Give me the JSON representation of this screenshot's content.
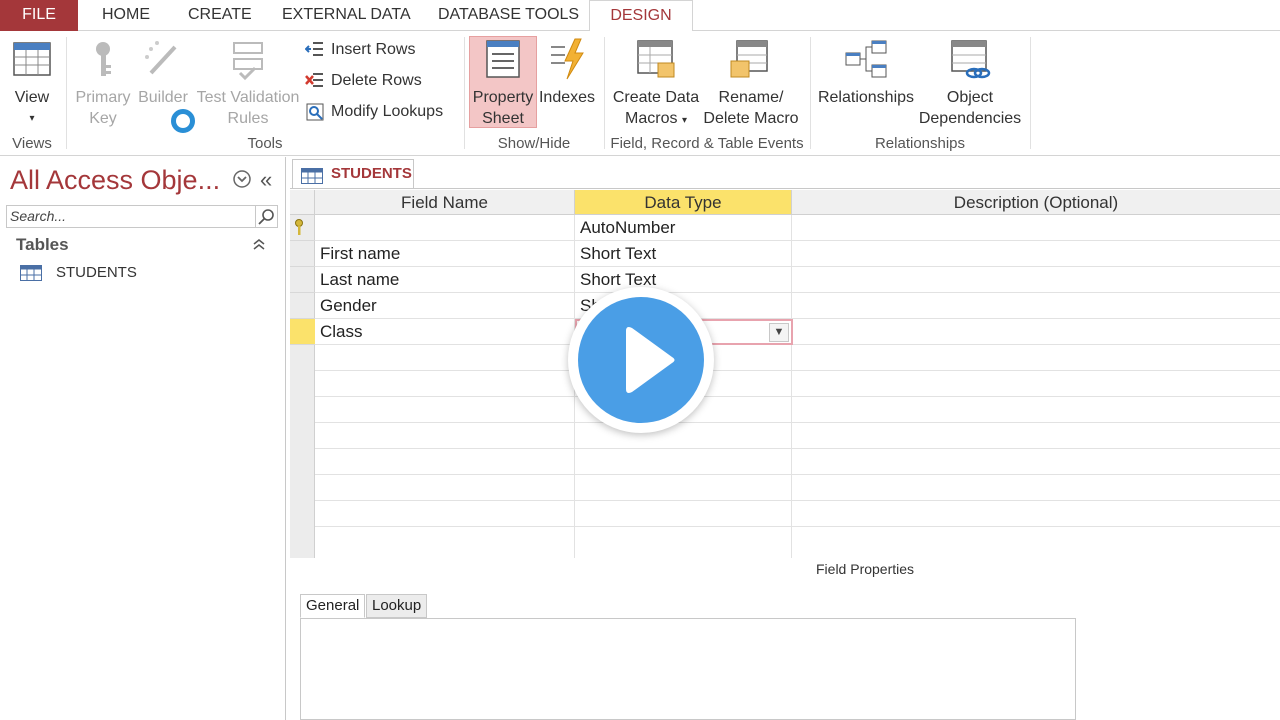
{
  "ribbon_tabs": [
    "FILE",
    "HOME",
    "CREATE",
    "EXTERNAL DATA",
    "DATABASE TOOLS",
    "DESIGN"
  ],
  "ribbon": {
    "views": {
      "view": "View",
      "label": "Views"
    },
    "tools": {
      "primary_key": "Primary\nKey",
      "builder": "Builder",
      "test_validation": "Test Validation\nRules",
      "insert_rows": "Insert Rows",
      "delete_rows": "Delete Rows",
      "modify_lookups": "Modify Lookups",
      "label": "Tools"
    },
    "showhide": {
      "property_sheet": "Property\nSheet",
      "indexes": "Indexes",
      "label": "Show/Hide"
    },
    "events": {
      "create_data_macros": "Create Data\nMacros",
      "rename_delete_macro": "Rename/\nDelete Macro",
      "label": "Field, Record & Table Events"
    },
    "relationships": {
      "relationships": "Relationships",
      "object_dependencies": "Object\nDependencies",
      "label": "Relationships"
    }
  },
  "nav": {
    "title": "All Access Obje...",
    "search_placeholder": "Search...",
    "section": "Tables",
    "items": [
      "STUDENTS"
    ]
  },
  "document": {
    "tab": "STUDENTS",
    "headers": [
      "Field Name",
      "Data Type",
      "Description (Optional)"
    ],
    "rows": [
      {
        "field": "",
        "type": "AutoNumber",
        "key": true
      },
      {
        "field": "First name",
        "type": "Short Text"
      },
      {
        "field": "Last name",
        "type": "Short Text"
      },
      {
        "field": "Gender",
        "type": "Sh"
      },
      {
        "field": "Class",
        "type": "",
        "current": true
      }
    ]
  },
  "field_properties": {
    "label": "Field Properties",
    "tabs": [
      "General",
      "Lookup"
    ]
  },
  "colors": {
    "access_red": "#a4373a",
    "selected_header": "#fbe26b",
    "play_blue": "#4a9ee6"
  }
}
